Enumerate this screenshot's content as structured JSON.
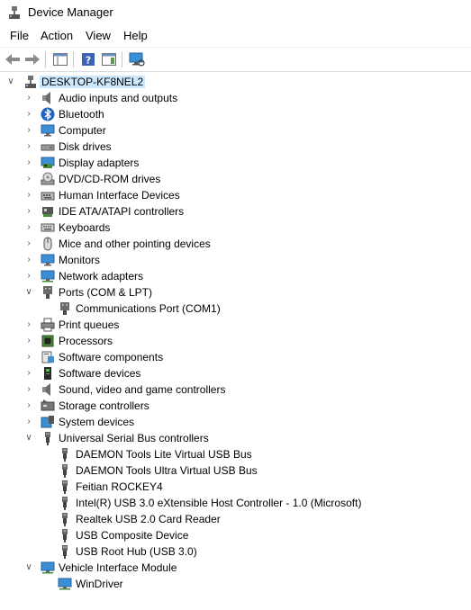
{
  "window": {
    "title": "Device Manager"
  },
  "menu": {
    "items": [
      "File",
      "Action",
      "View",
      "Help"
    ]
  },
  "tree": {
    "root": "DESKTOP-KF8NEL2",
    "categories": [
      {
        "label": "Audio inputs and outputs",
        "icon": "speaker-icon"
      },
      {
        "label": "Bluetooth",
        "icon": "bluetooth-icon"
      },
      {
        "label": "Computer",
        "icon": "monitor-icon"
      },
      {
        "label": "Disk drives",
        "icon": "disk-drive-icon"
      },
      {
        "label": "Display adapters",
        "icon": "display-adapter-icon"
      },
      {
        "label": "DVD/CD-ROM drives",
        "icon": "dvd-icon"
      },
      {
        "label": "Human Interface Devices",
        "icon": "hid-icon"
      },
      {
        "label": "IDE ATA/ATAPI controllers",
        "icon": "ide-controller-icon"
      },
      {
        "label": "Keyboards",
        "icon": "keyboard-icon"
      },
      {
        "label": "Mice and other pointing devices",
        "icon": "mouse-icon"
      },
      {
        "label": "Monitors",
        "icon": "monitor-icon"
      },
      {
        "label": "Network adapters",
        "icon": "network-icon"
      },
      {
        "label": "Ports (COM & LPT)",
        "icon": "port-icon",
        "expanded": true,
        "children": [
          {
            "label": "Communications Port (COM1)",
            "icon": "port-icon"
          }
        ]
      },
      {
        "label": "Print queues",
        "icon": "printer-icon"
      },
      {
        "label": "Processors",
        "icon": "processor-icon"
      },
      {
        "label": "Software components",
        "icon": "software-component-icon"
      },
      {
        "label": "Software devices",
        "icon": "software-device-icon"
      },
      {
        "label": "Sound, video and game controllers",
        "icon": "speaker-icon"
      },
      {
        "label": "Storage controllers",
        "icon": "storage-controller-icon"
      },
      {
        "label": "System devices",
        "icon": "system-device-icon"
      },
      {
        "label": "Universal Serial Bus controllers",
        "icon": "usb-icon",
        "expanded": true,
        "children": [
          {
            "label": "DAEMON Tools Lite Virtual USB Bus",
            "icon": "usb-icon"
          },
          {
            "label": "DAEMON Tools Ultra Virtual USB Bus",
            "icon": "usb-icon"
          },
          {
            "label": "Feitian ROCKEY4",
            "icon": "usb-icon"
          },
          {
            "label": "Intel(R) USB 3.0 eXtensible Host Controller - 1.0 (Microsoft)",
            "icon": "usb-icon"
          },
          {
            "label": "Realtek USB 2.0 Card Reader",
            "icon": "usb-icon"
          },
          {
            "label": "USB Composite Device",
            "icon": "usb-icon"
          },
          {
            "label": "USB Root Hub (USB 3.0)",
            "icon": "usb-icon"
          }
        ]
      },
      {
        "label": "Vehicle Interface Module",
        "icon": "network-icon",
        "expanded": true,
        "children": [
          {
            "label": "WinDriver",
            "icon": "network-icon"
          }
        ]
      }
    ]
  }
}
